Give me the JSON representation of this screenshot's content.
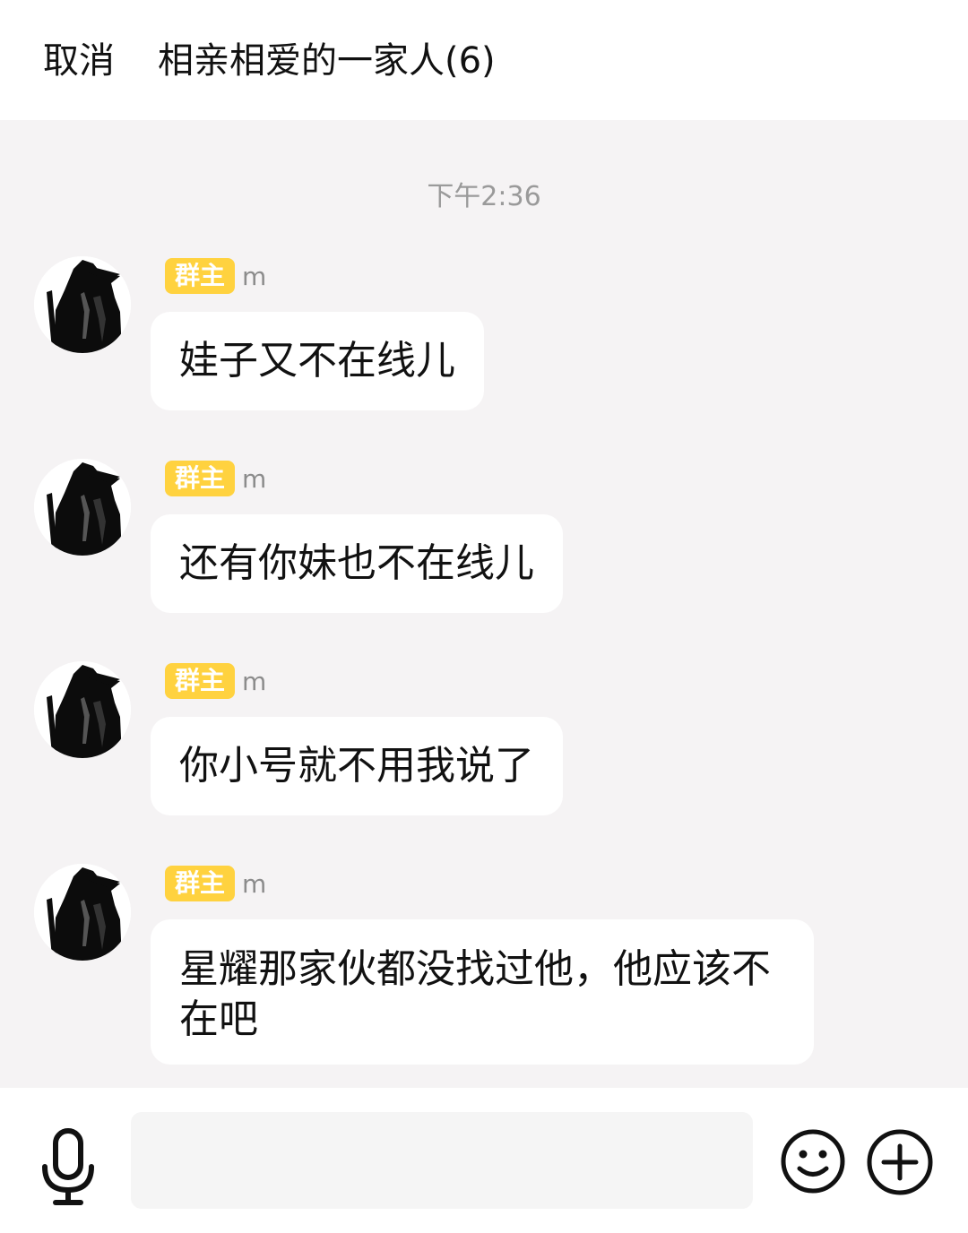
{
  "header": {
    "cancel_label": "取消",
    "title": "相亲相爱的一家人(6)"
  },
  "chat": {
    "timestamp": "下午2:36",
    "messages": [
      {
        "badge": "群主",
        "sender": "m",
        "text": "娃子又不在线儿"
      },
      {
        "badge": "群主",
        "sender": "m",
        "text": "还有你妹也不在线儿"
      },
      {
        "badge": "群主",
        "sender": "m",
        "text": "你小号就不用我说了"
      },
      {
        "badge": "群主",
        "sender": "m",
        "text": "星耀那家伙都没找过他，他应该不在吧"
      }
    ]
  },
  "input": {
    "value": "",
    "mic_icon": "microphone-icon",
    "emoji_icon": "smiley-icon",
    "plus_icon": "plus-circle-icon"
  },
  "colors": {
    "badge": "#ffd23f",
    "chat_background": "#f5f3f4",
    "bubble": "#ffffff"
  }
}
